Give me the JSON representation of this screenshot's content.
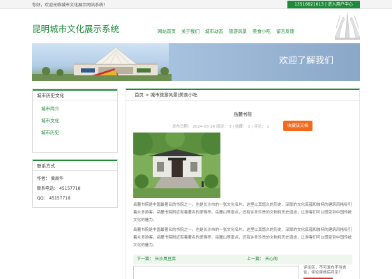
{
  "topbar": {
    "welcome": "你好，欢迎光临城市文化展示网站系统！",
    "contact": "13516821613 | 进入用户中心"
  },
  "header": {
    "site_title": "昆明城市文化展示系统",
    "nav": [
      "网站首页",
      "关于我们",
      "城市动态",
      "旅游风景",
      "美食小吃",
      "留言反馈"
    ]
  },
  "banner": {
    "text": "欢迎了解我们"
  },
  "sidebar": {
    "history_title": "城市历史文化",
    "history_links": [
      "城市简介",
      "城市文化",
      "城市历史"
    ],
    "contact_title": "联系方式",
    "contact_rows": [
      "作者：  黄周华",
      "联系电话：  45157718",
      "QQ：   45157718"
    ]
  },
  "main": {
    "breadcrumb": "首页 > 城市旅游风景|美食小吃",
    "article_title": "岳麓书院",
    "meta": "发布日期：  2024-05-24    阅读：  3   |    收藏：  1   |    评论：  1",
    "favorite_label": "收藏该文档",
    "paragraph_1": "岳麓书院是中国最著名的书院之一，也是长沙市的一张文化名片。这里以其悠久的历史、深厚的文化底蕴和独特的建筑风格吸引着众多游客。岳麓书院附近有着著名的爱晚亭、岳麓山等景点，还有许多珍贵的文物和历史遗迹，让游客们可以感受到中国传统文化的魅力。",
    "paragraph_2": "岳麓书院是中国最著名的书院之一，也是长沙市的一张文化名片。这里以其悠久的历史、深厚的文化底蕴和独特的建筑风格吸引着众多游客。岳麓书院附近有着著名的爱晚亭、岳麓山等景点，还有许多珍贵的文物和历史遗迹，让游客们可以感受到中国传统文化的魅力。",
    "prev_label": "下一篇：",
    "prev_link": "长沙臭豆腐",
    "next_label": "上一篇：",
    "next_link": "天心阁",
    "comment_note": "评论区，不可发布不当言论，评论审核后可见！"
  },
  "colors": {
    "accent": "#1e8a3a",
    "button_orange": "#f36a1d"
  }
}
